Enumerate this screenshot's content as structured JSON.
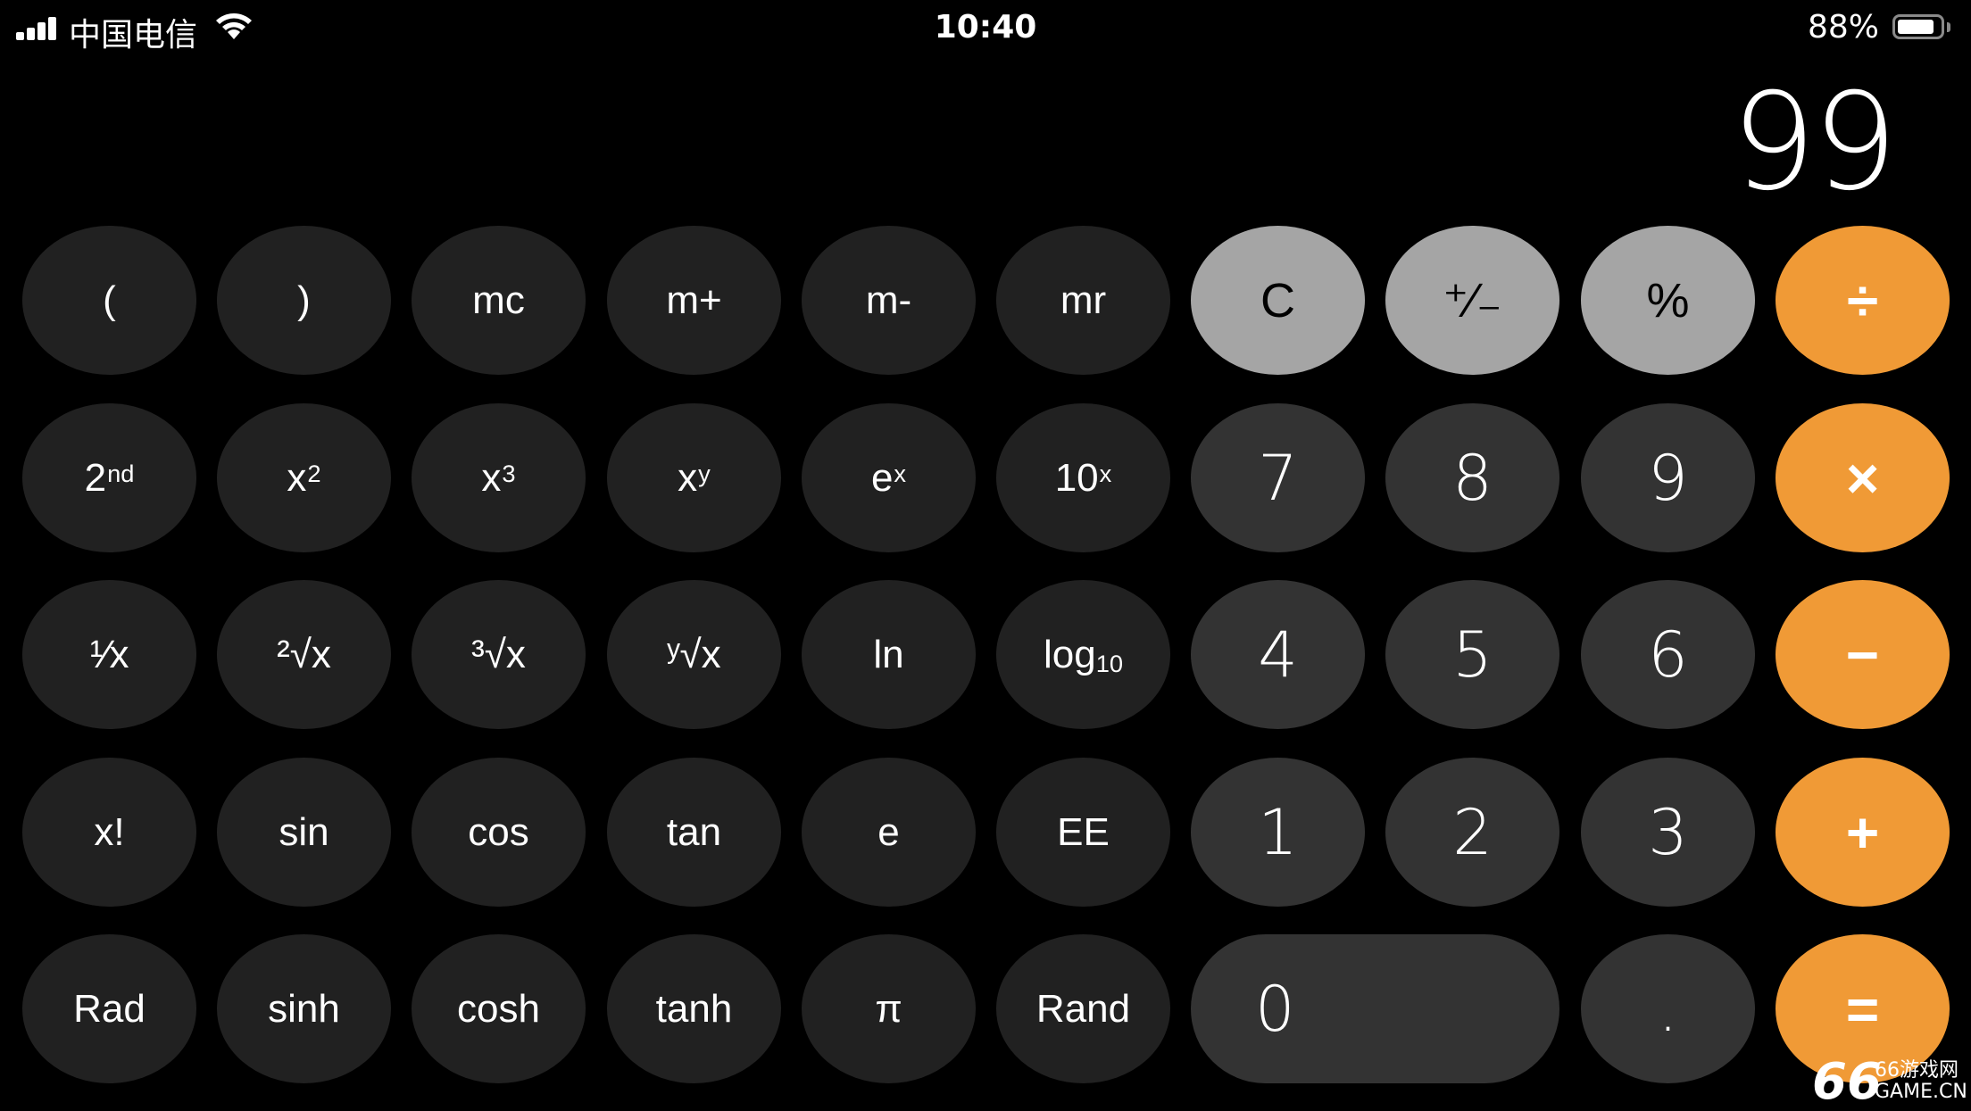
{
  "status_bar": {
    "carrier": "中国电信",
    "time": "10:40",
    "battery_percent": "88%",
    "battery_level": 0.88,
    "signal_bars": 4,
    "icons": [
      "signal-bars-icon",
      "wifi-icon",
      "battery-icon"
    ]
  },
  "display": {
    "value": "99"
  },
  "keys": {
    "row1": [
      {
        "id": "open-paren",
        "label": "(",
        "style": "fn"
      },
      {
        "id": "close-paren",
        "label": ")",
        "style": "fn"
      },
      {
        "id": "mc",
        "label": "mc",
        "style": "fn"
      },
      {
        "id": "m-plus",
        "label": "m+",
        "style": "fn"
      },
      {
        "id": "m-minus",
        "label": "m-",
        "style": "fn"
      },
      {
        "id": "mr",
        "label": "mr",
        "style": "fn"
      },
      {
        "id": "clear",
        "label": "C",
        "style": "gray"
      },
      {
        "id": "plus-minus",
        "label": "⁺∕₋",
        "style": "gray"
      },
      {
        "id": "percent",
        "label": "%",
        "style": "gray"
      },
      {
        "id": "divide",
        "label": "÷",
        "style": "op"
      }
    ],
    "row2": [
      {
        "id": "second",
        "base": "2",
        "sup": "nd",
        "style": "fn"
      },
      {
        "id": "x-squared",
        "base": "x",
        "sup": "2",
        "style": "fn"
      },
      {
        "id": "x-cubed",
        "base": "x",
        "sup": "3",
        "style": "fn"
      },
      {
        "id": "x-to-y",
        "base": "x",
        "sup": "y",
        "style": "fn"
      },
      {
        "id": "e-to-x",
        "base": "e",
        "sup": "x",
        "style": "fn"
      },
      {
        "id": "ten-to-x",
        "base": "10",
        "sup": "x",
        "style": "fn"
      },
      {
        "id": "seven",
        "label": "7",
        "style": "num"
      },
      {
        "id": "eight",
        "label": "8",
        "style": "num"
      },
      {
        "id": "nine",
        "label": "9",
        "style": "num"
      },
      {
        "id": "multiply",
        "label": "×",
        "style": "op"
      }
    ],
    "row3": [
      {
        "id": "reciprocal",
        "label": "¹∕x",
        "style": "fn"
      },
      {
        "id": "square-root",
        "label": "²√x",
        "style": "fn"
      },
      {
        "id": "cube-root",
        "label": "³√x",
        "style": "fn"
      },
      {
        "id": "y-root",
        "label": "ʸ√x",
        "style": "fn"
      },
      {
        "id": "ln",
        "label": "ln",
        "style": "fn"
      },
      {
        "id": "log10",
        "base": "log",
        "sub": "10",
        "style": "fn"
      },
      {
        "id": "four",
        "label": "4",
        "style": "num"
      },
      {
        "id": "five",
        "label": "5",
        "style": "num"
      },
      {
        "id": "six",
        "label": "6",
        "style": "num"
      },
      {
        "id": "subtract",
        "label": "−",
        "style": "op"
      }
    ],
    "row4": [
      {
        "id": "factorial",
        "label": "x!",
        "style": "fn"
      },
      {
        "id": "sin",
        "label": "sin",
        "style": "fn"
      },
      {
        "id": "cos",
        "label": "cos",
        "style": "fn"
      },
      {
        "id": "tan",
        "label": "tan",
        "style": "fn"
      },
      {
        "id": "e",
        "label": "e",
        "style": "fn"
      },
      {
        "id": "ee",
        "label": "EE",
        "style": "fn"
      },
      {
        "id": "one",
        "label": "1",
        "style": "num"
      },
      {
        "id": "two",
        "label": "2",
        "style": "num"
      },
      {
        "id": "three",
        "label": "3",
        "style": "num"
      },
      {
        "id": "add",
        "label": "+",
        "style": "op"
      }
    ],
    "row5": [
      {
        "id": "rad",
        "label": "Rad",
        "style": "fn"
      },
      {
        "id": "sinh",
        "label": "sinh",
        "style": "fn"
      },
      {
        "id": "cosh",
        "label": "cosh",
        "style": "fn"
      },
      {
        "id": "tanh",
        "label": "tanh",
        "style": "fn"
      },
      {
        "id": "pi",
        "label": "π",
        "style": "fn"
      },
      {
        "id": "rand",
        "label": "Rand",
        "style": "fn"
      },
      {
        "id": "zero",
        "label": "0",
        "style": "num zero"
      },
      {
        "id": "decimal",
        "label": ".",
        "style": "num"
      },
      {
        "id": "equals",
        "label": "=",
        "style": "op"
      }
    ]
  },
  "colors": {
    "background": "#000000",
    "function_key": "#212121",
    "digit_key": "#333333",
    "utility_key": "#a5a5a5",
    "operator_key": "#f09a36"
  },
  "watermark": {
    "mark": "66",
    "line1": "66游戏网",
    "line2": "GAME.CN"
  }
}
